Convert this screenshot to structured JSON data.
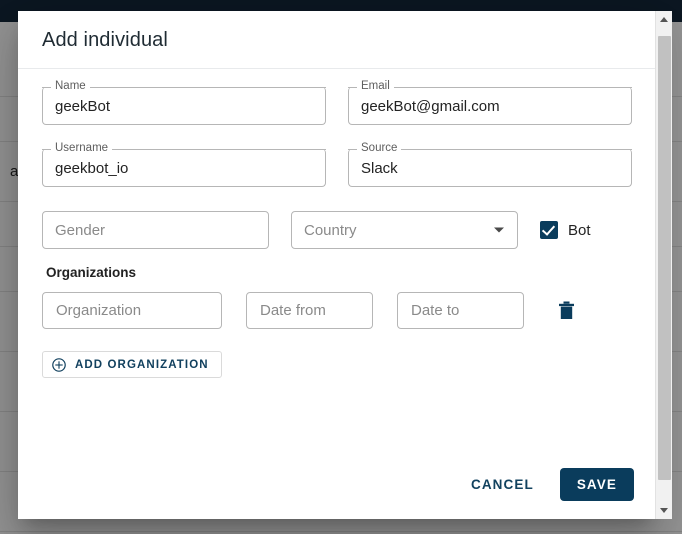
{
  "background": {
    "topbar_color": "#16293b",
    "rows": [
      {
        "text": ""
      },
      {
        "text": ""
      },
      {
        "text": "at"
      },
      {
        "text": ""
      },
      {
        "text": ""
      },
      {
        "text": ""
      },
      {
        "text": ""
      },
      {
        "text": ""
      },
      {
        "text": ""
      }
    ]
  },
  "dialog": {
    "title": "Add individual",
    "fields": {
      "name": {
        "label": "Name",
        "value": "geekBot",
        "placeholder": ""
      },
      "email": {
        "label": "Email",
        "value": "geekBot@gmail.com",
        "placeholder": ""
      },
      "username": {
        "label": "Username",
        "value": "geekbot_io",
        "placeholder": ""
      },
      "source": {
        "label": "Source",
        "value": "Slack",
        "placeholder": ""
      },
      "gender": {
        "label": "",
        "value": "",
        "placeholder": "Gender"
      },
      "country": {
        "label": "",
        "value": "",
        "placeholder": "Country",
        "caret_icon": "chevron-down-icon"
      }
    },
    "bot_checkbox": {
      "label": "Bot",
      "checked": true,
      "color": "#0a3c5c"
    },
    "organizations": {
      "section_title": "Organizations",
      "rows": [
        {
          "organization": {
            "value": "",
            "placeholder": "Organization"
          },
          "date_from": {
            "value": "",
            "placeholder": "Date from"
          },
          "date_to": {
            "value": "",
            "placeholder": "Date to"
          },
          "delete_icon": "trash-icon"
        }
      ],
      "add_button": {
        "label": "ADD ORGANIZATION",
        "icon": "plus-circle-icon"
      }
    },
    "footer": {
      "cancel_label": "CANCEL",
      "save_label": "SAVE"
    }
  },
  "scrollbar": {
    "up_icon": "chevron-up-icon",
    "down_icon": "chevron-down-icon",
    "track_color": "#f1f1f1",
    "thumb_color": "#c1c1c1"
  },
  "theme": {
    "accent": "#0a3c5c",
    "border": "#b6b6b6",
    "placeholder": "#8a8a8a"
  }
}
